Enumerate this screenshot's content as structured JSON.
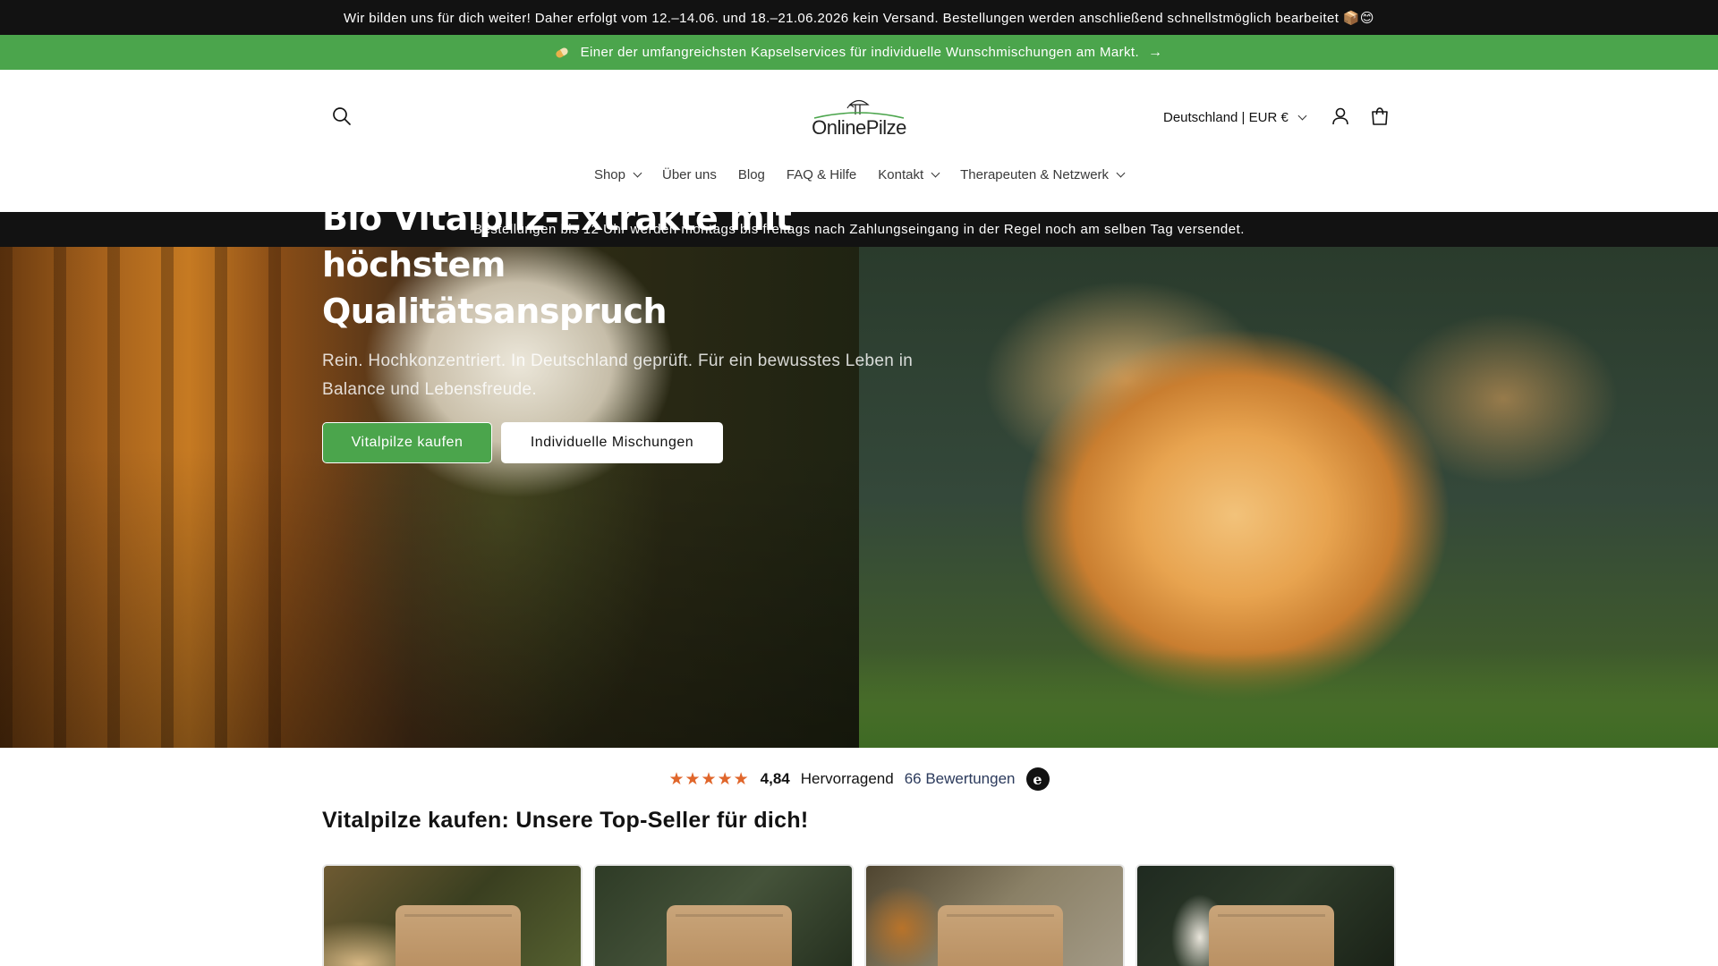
{
  "announcement": {
    "text": "Wir bilden uns für dich weiter! Daher erfolgt vom 12.–14.06. und 18.–21.06.2026 kein Versand. Bestellungen werden anschließend schnellstmöglich bearbeitet 📦😊"
  },
  "promo": {
    "text": "Einer der umfangreichsten Kapselservices für individuelle Wunschmischungen am Markt.",
    "icon": "pill-icon",
    "arrow": "→"
  },
  "header": {
    "logo_text": "OnlinePilze",
    "country_selector": "Deutschland | EUR €",
    "icons": [
      "search-icon",
      "account-icon",
      "cart-icon"
    ]
  },
  "nav": {
    "items": [
      {
        "label": "Shop",
        "dropdown": true
      },
      {
        "label": "Über uns",
        "dropdown": false
      },
      {
        "label": "Blog",
        "dropdown": false
      },
      {
        "label": "FAQ & Hilfe",
        "dropdown": false
      },
      {
        "label": "Kontakt",
        "dropdown": true
      },
      {
        "label": "Therapeuten & Netzwerk",
        "dropdown": true
      }
    ]
  },
  "shipping_bar": {
    "text": "Bestellungen bis 12 Uhr werden montags bis freitags nach Zahlungseingang in der Regel noch am selben Tag versendet."
  },
  "hero": {
    "title_line1": "Bio Vitalpilz-Extrakte mit höchstem",
    "title_line2": "Qualitätsanspruch",
    "subtitle": "Rein. Hochkonzentriert. In Deutschland geprüft. Für ein bewusstes Leben in Balance und Lebensfreude.",
    "primary_button": "Vitalpilze kaufen",
    "secondary_button": "Individuelle Mischungen"
  },
  "rating": {
    "stars": "★★★★★",
    "score": "4,84",
    "label": "Hervorragend",
    "count": "66 Bewertungen",
    "badge": "e"
  },
  "bestsellers": {
    "title": "Vitalpilze kaufen: Unsere Top-Seller für dich!"
  },
  "colors": {
    "accent_green": "#4ba54c",
    "dark": "#121212",
    "star_orange": "#e0662b"
  }
}
